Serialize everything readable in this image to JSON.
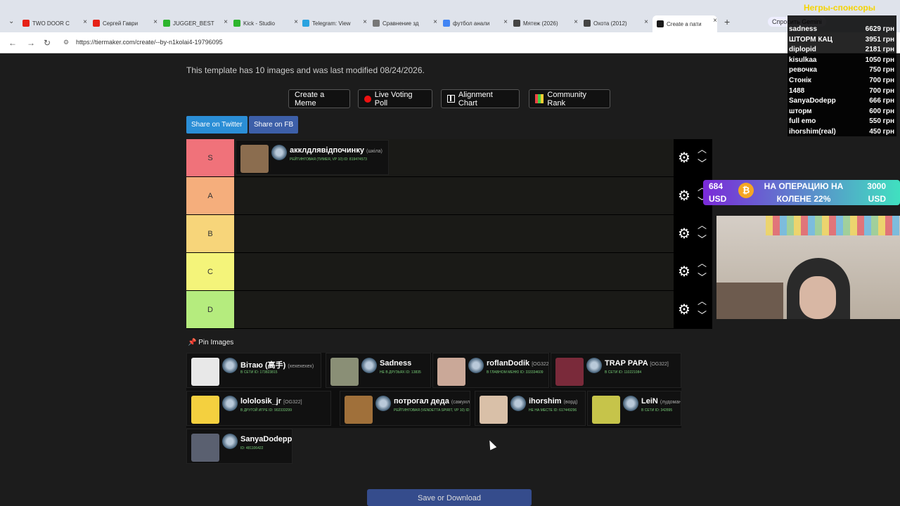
{
  "browser": {
    "tabs": [
      {
        "label": "TWO DOOR C",
        "color": "#e62117"
      },
      {
        "label": "Сергей Гаври",
        "color": "#e62117"
      },
      {
        "label": "JUGGER_BEST",
        "color": "#2db52d"
      },
      {
        "label": "Kick - Studio",
        "color": "#2db52d"
      },
      {
        "label": "Telegram: View",
        "color": "#2aa3e0"
      },
      {
        "label": "Сравнение зд",
        "color": "#777777"
      },
      {
        "label": "футбол анали",
        "color": "#4285f4"
      },
      {
        "label": "Мятеж (2026)",
        "color": "#444444"
      },
      {
        "label": "Охота (2012)",
        "color": "#444444"
      },
      {
        "label": "Create a пати",
        "color": "#1a1a1a"
      }
    ],
    "gemini_label": "Спросить Gemini",
    "url": "https://tiermaker.com/create/--by-n1kolai4-19796095"
  },
  "page": {
    "info": "This template has 10 images and was last modified 08/24/2026.",
    "buttons": {
      "meme": "Create a Meme",
      "poll": "Live Voting Poll",
      "alignment": "Alignment Chart",
      "rank": "Community Rank"
    },
    "share": {
      "twitter": "Share on Twitter",
      "fb": "Share on FB",
      "twitter_color": "#2b8ed6",
      "fb_color": "#3d5fa8"
    },
    "tiers": [
      {
        "label": "S",
        "color": "#f0727a"
      },
      {
        "label": "A",
        "color": "#f5ae7c"
      },
      {
        "label": "B",
        "color": "#f7d57a"
      },
      {
        "label": "C",
        "color": "#f4f47a"
      },
      {
        "label": "D",
        "color": "#b5ec7e"
      }
    ],
    "s_item": {
      "nick": "акклдлявідпочинку",
      "tag": "(шкіла)",
      "sub": "РЕЙТИНГОВАЯ (ТИМЕЯ, VP 10)   ID: 819474573"
    },
    "pin_title": "Pin Images",
    "pinned": [
      {
        "nick": "Вітаю (高手)",
        "tag": "(хехехехех)",
        "sub": "В СЕТИ   ID: 173823815"
      },
      {
        "nick": "Sadness",
        "tag": "",
        "sub": "НЕ В ДРУЗЬЯХ   ID: 13835"
      },
      {
        "nick": "roflanDodik",
        "tag": "[OG322]",
        "sub": "В ГЛАВНОМ МЕНЮ   ID: 333334609"
      },
      {
        "nick": "TRAP PAPA",
        "tag": "[OG322]",
        "sub": "В СЕТИ   ID: 110221084"
      },
      {
        "nick": "lololosik_jr",
        "tag": "[OG322]",
        "sub": "В ДРУГОЙ ИГРЕ   ID: 902333299"
      },
      {
        "nick": "потрогал деда",
        "tag": "(самуил)",
        "sub": "РЕЙТИНГОВАЯ (VENDETTA SPIRIT, VP 10)   ID: 113"
      },
      {
        "nick": "ihorshim",
        "tag": "(ворд)",
        "sub": "НЕ НА МЕСТЕ   ID: 617449296"
      },
      {
        "nick": "LeiN",
        "tag": "(лудоман)",
        "sub": "В СЕТИ   ID: 342895"
      },
      {
        "nick": "SanyaDodepp",
        "tag": "",
        "sub": "ID: 481106422"
      }
    ],
    "save_label": "Save or Download"
  },
  "overlay": {
    "title": "Негры-спонсоры",
    "donations": [
      {
        "name": "sadness",
        "amount": "6629 грн"
      },
      {
        "name": "ШТОРМ КАЦ",
        "amount": "3951 грн"
      },
      {
        "name": "diplopid",
        "amount": "2181 грн"
      },
      {
        "name": "kisulkaa",
        "amount": "1050 грн"
      },
      {
        "name": "ревочка",
        "amount": "750 грн"
      },
      {
        "name": "Стонік",
        "amount": "700 грн"
      },
      {
        "name": "1488",
        "amount": "700 грн"
      },
      {
        "name": "SanyaDodepp",
        "amount": "666 грн"
      },
      {
        "name": "шторм",
        "amount": "600 грн"
      },
      {
        "name": "full emo",
        "amount": "550 грн"
      },
      {
        "name": "ihorshim(real)",
        "amount": "450 грн"
      }
    ],
    "goal": {
      "current": "684",
      "current_unit": "USD",
      "title": "НА ОПЕРАЦИЮ НА КОЛЕНЕ 22%",
      "total": "3000",
      "total_unit": "USD",
      "coin_symbol": "₿"
    }
  }
}
